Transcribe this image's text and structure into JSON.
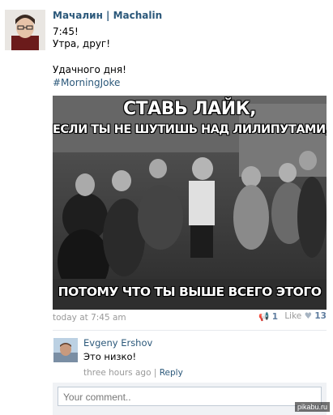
{
  "post": {
    "author": "Мачалин | Machalin",
    "lines": [
      "7:45!",
      "Утра, друг!",
      "Удачного дня!"
    ],
    "hashtag": "#MorningJoke",
    "image": {
      "top_line1": "СТАВЬ ЛАЙК,",
      "top_line2": "ЕСЛИ ТЫ НЕ ШУТИШЬ НАД ЛИЛИПУТАМИ,",
      "bottom_line": "ПОТОМУ ЧТО ТЫ ВЫШЕ ВСЕГО ЭТОГО"
    },
    "time": "today at 7:45 am",
    "repost_count": "1",
    "like_label": "Like",
    "like_count": "13"
  },
  "comment": {
    "author": "Evgeny Ershov",
    "text": "Это низко!",
    "time": "three hours ago",
    "separator": "|",
    "reply_label": "Reply"
  },
  "comment_input": {
    "placeholder": "Your comment.."
  },
  "watermark": "pikabu.ru",
  "icons": [
    "repost-icon",
    "heart-icon"
  ],
  "colors": {
    "link": "#2b587a",
    "meta": "#999999",
    "accent": "#5f7d9f"
  }
}
